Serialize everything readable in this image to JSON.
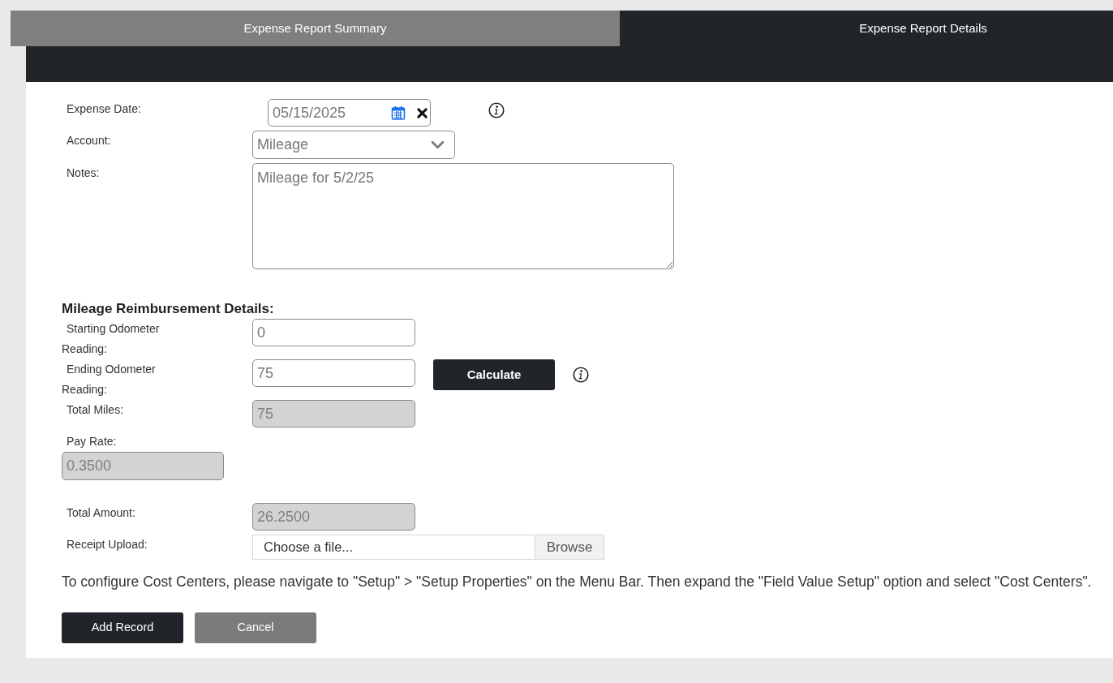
{
  "tabs": [
    {
      "label": "Expense Report Summary",
      "selected": false
    },
    {
      "label": "Expense Report Details",
      "selected": true
    }
  ],
  "expense": {
    "fields": [
      {
        "kind": "date",
        "label": "Expense Date:",
        "value": "05/15/2025",
        "info": true
      },
      {
        "kind": "select",
        "label": "Account:",
        "value": "Mileage"
      },
      {
        "kind": "textarea",
        "label": "Notes:",
        "value": "Mileage for 5/2/25"
      }
    ]
  },
  "mileage": {
    "heading": "Mileage Reimbursement Details:",
    "fields": [
      {
        "kind": "input",
        "label": "Starting Odometer Reading:",
        "value": "0",
        "disabled": false
      },
      {
        "kind": "input",
        "label": "Ending Odometer Reading:",
        "value": "75",
        "disabled": false,
        "button": "Calculate",
        "info": true
      },
      {
        "kind": "input",
        "label": "Total Miles:",
        "value": "75",
        "disabled": true
      },
      {
        "kind": "stacked-input",
        "label": "Pay Rate:",
        "value": "0.3500",
        "disabled": true
      },
      {
        "kind": "input",
        "label": "Total Amount:",
        "value": "26.2500",
        "disabled": true
      },
      {
        "kind": "file",
        "label": "Receipt Upload:",
        "placeholder": "Choose a file...",
        "button": "Browse"
      }
    ]
  },
  "note": "To configure Cost Centers, please navigate to \"Setup\" > \"Setup Properties\" on the Menu Bar. Then expand the \"Field Value Setup\" option and select \"Cost Centers\".",
  "buttons": [
    {
      "label": "Add Record",
      "kind": "primary"
    },
    {
      "label": "Cancel",
      "kind": "secondary"
    }
  ]
}
